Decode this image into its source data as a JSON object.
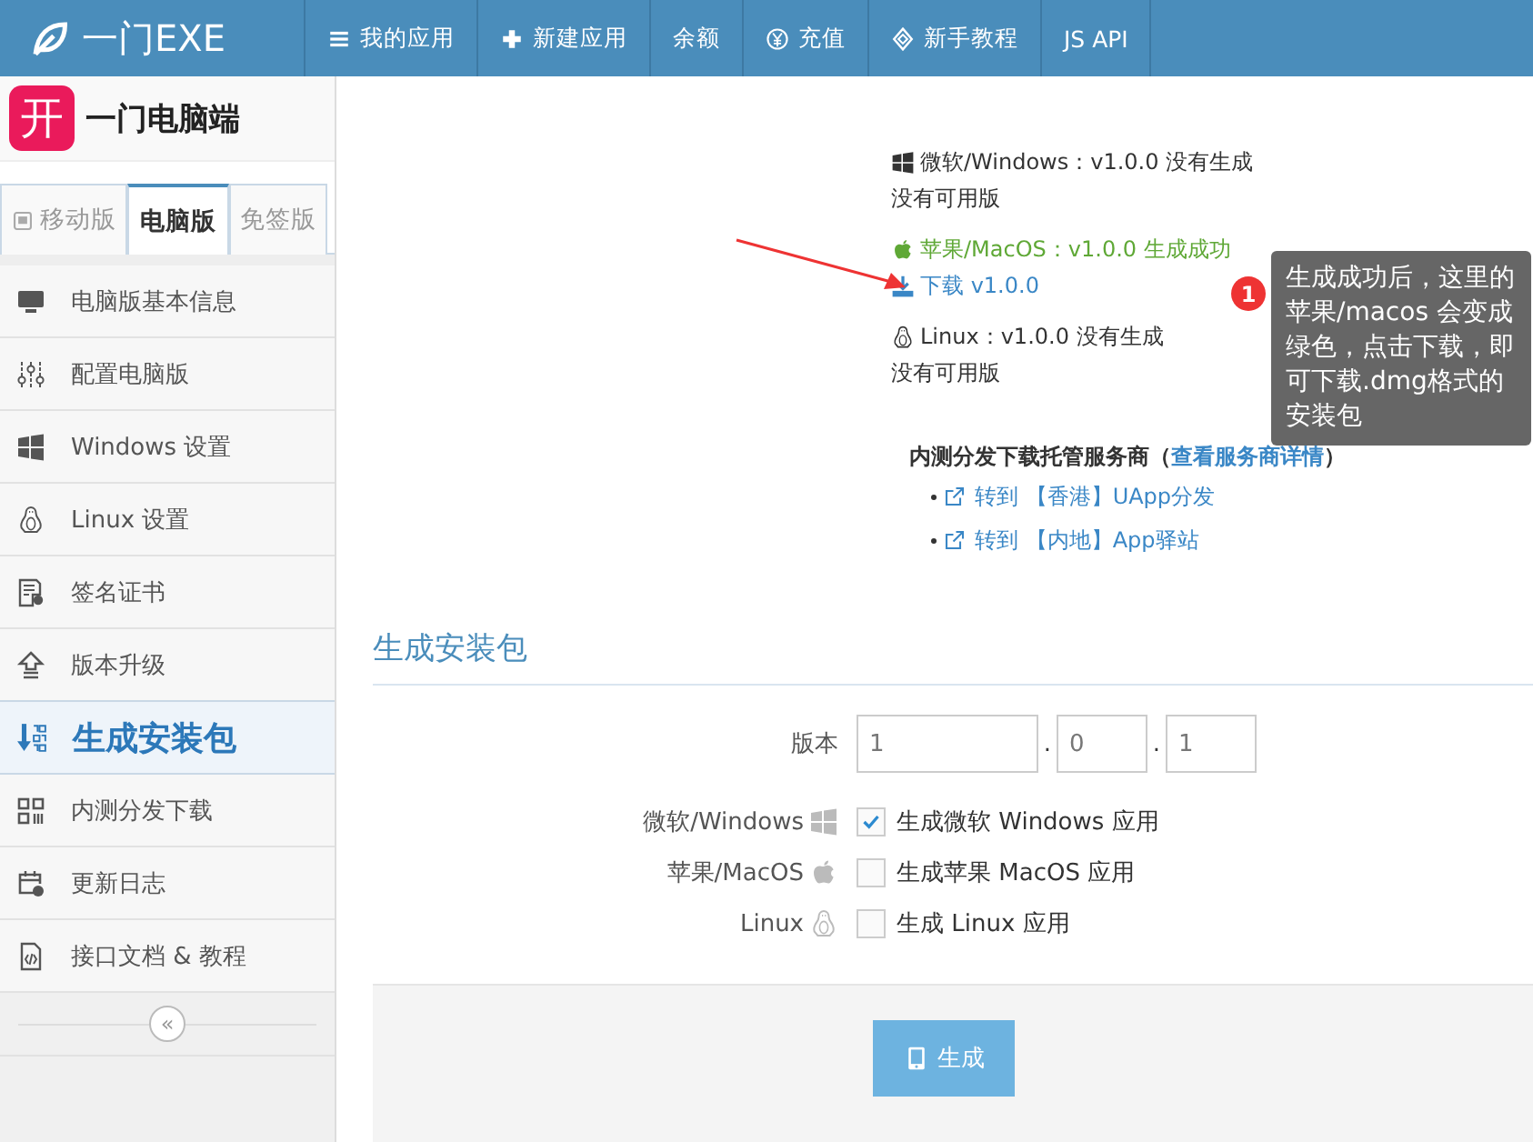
{
  "app": {
    "logo": "一门EXE"
  },
  "nav": [
    {
      "label": "我的应用"
    },
    {
      "label": "新建应用"
    },
    {
      "label": "余额"
    },
    {
      "label": "充值"
    },
    {
      "label": "新手教程"
    },
    {
      "label": "JS API"
    }
  ],
  "sidebar": {
    "app_icon": "开",
    "app_name": "一门电脑端",
    "tabs": [
      {
        "label": "移动版",
        "selected": false
      },
      {
        "label": "电脑版",
        "selected": true
      },
      {
        "label": "免签版",
        "selected": false
      }
    ],
    "items": [
      {
        "label": "电脑版基本信息",
        "selected": false
      },
      {
        "label": "配置电脑版",
        "selected": false
      },
      {
        "label": "Windows 设置",
        "selected": false
      },
      {
        "label": "Linux 设置",
        "selected": false
      },
      {
        "label": "签名证书",
        "selected": false
      },
      {
        "label": "版本升级",
        "selected": false
      },
      {
        "label": "生成安装包",
        "selected": true
      },
      {
        "label": "内测分发下载",
        "selected": false
      },
      {
        "label": "更新日志",
        "selected": false
      },
      {
        "label": "接口文档 & 教程",
        "selected": false
      }
    ],
    "collapse": "«"
  },
  "platforms": [
    {
      "kind": "windows",
      "status": "微软/Windows：v1.0.0 没有生成",
      "success": false,
      "note": "没有可用版"
    },
    {
      "kind": "mac",
      "status": "苹果/MacOS：v1.0.0 生成成功",
      "success": true,
      "download": "下载 v1.0.0"
    },
    {
      "kind": "linux",
      "status": "Linux：v1.0.0 没有生成",
      "success": false,
      "note": "没有可用版"
    }
  ],
  "hosting": {
    "title": "内测分发下载托管服务商（",
    "link": "查看服务商详情",
    "title_end": "）",
    "links": [
      "转到 【香港】UApp分发",
      "转到 【内地】App驿站"
    ]
  },
  "tooltip": {
    "badge": "1",
    "text": "生成成功后，这里的苹果/macos 会变成绿色，点击下载，即可下载.dmg格式的安装包"
  },
  "form": {
    "title": "生成安装包",
    "version_label": "版本",
    "version": [
      "1",
      "0",
      "1"
    ],
    "separators": [
      ".",
      "."
    ],
    "options": [
      {
        "kind": "windows",
        "label": "微软/Windows",
        "option": "生成微软 Windows 应用",
        "checked": true
      },
      {
        "kind": "mac",
        "label": "苹果/MacOS",
        "option": "生成苹果 MacOS 应用",
        "checked": false
      },
      {
        "kind": "linux",
        "label": "Linux",
        "option": "生成 Linux 应用",
        "checked": false
      }
    ],
    "button": "生成"
  }
}
